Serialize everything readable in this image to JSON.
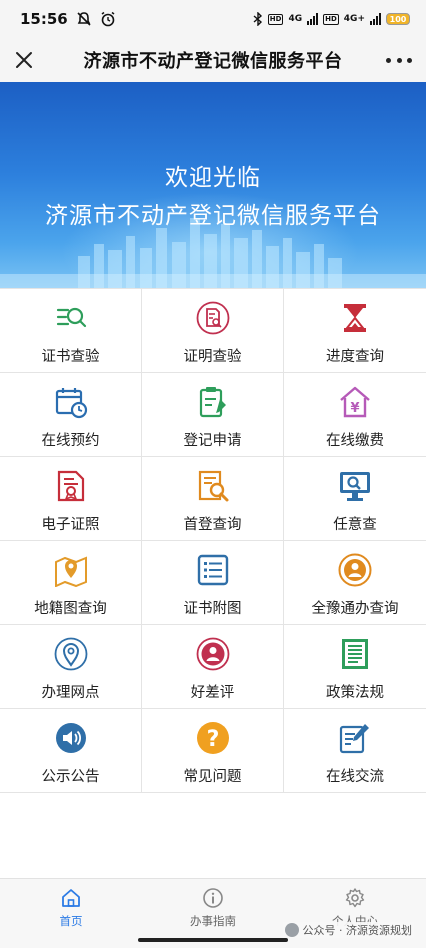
{
  "status_bar": {
    "time": "15:56",
    "network_label_1": "4G",
    "network_label_2": "4G+",
    "battery_level": "100"
  },
  "title_bar": {
    "title": "济源市不动产登记微信服务平台"
  },
  "banner": {
    "line1": "欢迎光临",
    "line2": "济源市不动产登记微信服务平台"
  },
  "grid": [
    {
      "label": "证书查验",
      "icon": "certificate-search-icon",
      "color": "#2e9e5b"
    },
    {
      "label": "证明查验",
      "icon": "proof-check-icon",
      "color": "#c0304f"
    },
    {
      "label": "进度查询",
      "icon": "hourglass-icon",
      "color": "#c62e3a"
    },
    {
      "label": "在线预约",
      "icon": "calendar-clock-icon",
      "color": "#2a6db0"
    },
    {
      "label": "登记申请",
      "icon": "clipboard-pen-icon",
      "color": "#2e9e5b"
    },
    {
      "label": "在线缴费",
      "icon": "house-yen-icon",
      "color": "#b65ab8"
    },
    {
      "label": "电子证照",
      "icon": "e-license-icon",
      "color": "#c62e3a"
    },
    {
      "label": "首登查询",
      "icon": "document-magnifier-icon",
      "color": "#e08a1e"
    },
    {
      "label": "任意查",
      "icon": "monitor-search-icon",
      "color": "#2f6fa8"
    },
    {
      "label": "地籍图查询",
      "icon": "map-pin-icon",
      "color": "#e39b2a"
    },
    {
      "label": "证书附图",
      "icon": "list-icon",
      "color": "#2f6fa8"
    },
    {
      "label": "全豫通办查询",
      "icon": "user-circle-icon",
      "color": "#e08a1e"
    },
    {
      "label": "办理网点",
      "icon": "location-icon",
      "color": "#2f6fa8"
    },
    {
      "label": "好差评",
      "icon": "evaluation-icon",
      "color": "#c0304f"
    },
    {
      "label": "政策法规",
      "icon": "regulation-document-icon",
      "color": "#2e9e5b"
    },
    {
      "label": "公示公告",
      "icon": "speaker-icon",
      "color": "#2f6fa8"
    },
    {
      "label": "常见问题",
      "icon": "question-icon",
      "color": "#f0a020"
    },
    {
      "label": "在线交流",
      "icon": "chat-edit-icon",
      "color": "#2f6fa8"
    }
  ],
  "tab_bar": {
    "tabs": [
      {
        "label": "首页",
        "icon": "home-icon",
        "active": true
      },
      {
        "label": "办事指南",
        "icon": "info-icon",
        "active": false
      },
      {
        "label": "个人中心",
        "icon": "gear-icon",
        "active": false
      }
    ],
    "active_color": "#2c7be5"
  },
  "watermark": {
    "text": "公众号 · 济源资源规划"
  }
}
